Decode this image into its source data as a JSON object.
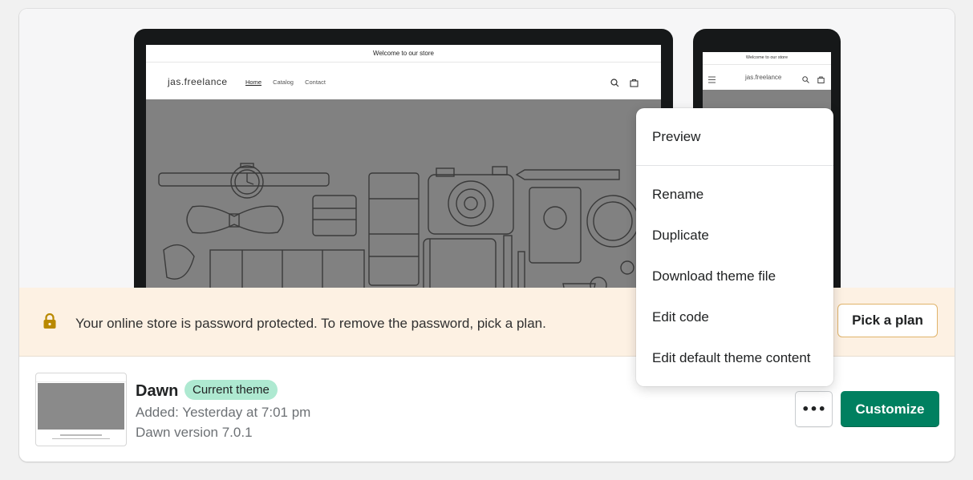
{
  "preview": {
    "desktop": {
      "announcement": "Welcome to our store",
      "store_name": "jas.freelance",
      "nav": [
        "Home",
        "Catalog",
        "Contact"
      ]
    },
    "mobile": {
      "announcement": "Welcome to our store",
      "store_name": "jas.freelance"
    }
  },
  "banner": {
    "message": "Your online store is password protected. To remove the password, pick a plan.",
    "button_label": "Pick a plan",
    "background": "#fdf1e3",
    "lock_icon": "lock-icon"
  },
  "theme": {
    "name": "Dawn",
    "badge": "Current theme",
    "added": "Added: Yesterday at 7:01 pm",
    "version": "Dawn version 7.0.1",
    "badge_color": "#aee9d1"
  },
  "actions": {
    "more_label": "•••",
    "customize_label": "Customize",
    "customize_color": "#008060"
  },
  "menu": {
    "items": [
      "Preview",
      "Rename",
      "Duplicate",
      "Download theme file",
      "Edit code",
      "Edit default theme content"
    ]
  }
}
